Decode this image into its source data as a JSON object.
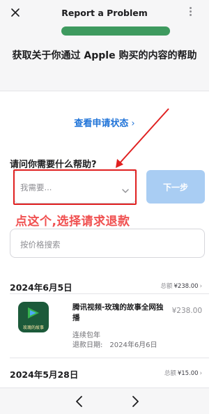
{
  "nav": {
    "title": "Report a Problem"
  },
  "hero": {
    "text": "获取关于你通过 Apple 购买的内容的帮助"
  },
  "status_link": {
    "label": "查看申请状态",
    "chevron": "›"
  },
  "help": {
    "question": "请问你需要什么帮助?",
    "select_placeholder": "我需要...",
    "next_label": "下一步"
  },
  "annotation": {
    "text": "点这个,选择请求退款",
    "color": "#f05050"
  },
  "search": {
    "placeholder": "按价格搜索"
  },
  "groups": [
    {
      "date": "2024年6月5日",
      "total_label": "总额",
      "total_value": "¥238.00",
      "item": {
        "icon_caption": "玫瑰的故事",
        "title": "腾讯视频-玫瑰的故事全网独播",
        "subtitle": "连续包年",
        "refund_label": "退款日期:",
        "refund_date": "2024年6月6日",
        "price": "¥238.00"
      }
    },
    {
      "date": "2024年5月28日",
      "total_label": "总额",
      "total_value": "¥15.00"
    }
  ],
  "colors": {
    "accent": "#1f73d8",
    "annotation_red": "#e02020",
    "button_disabled": "#a9cdf3"
  },
  "icons": [
    "close-icon",
    "more-icon",
    "chevron-down-icon",
    "chevron-right-icon",
    "back-icon",
    "forward-icon"
  ]
}
